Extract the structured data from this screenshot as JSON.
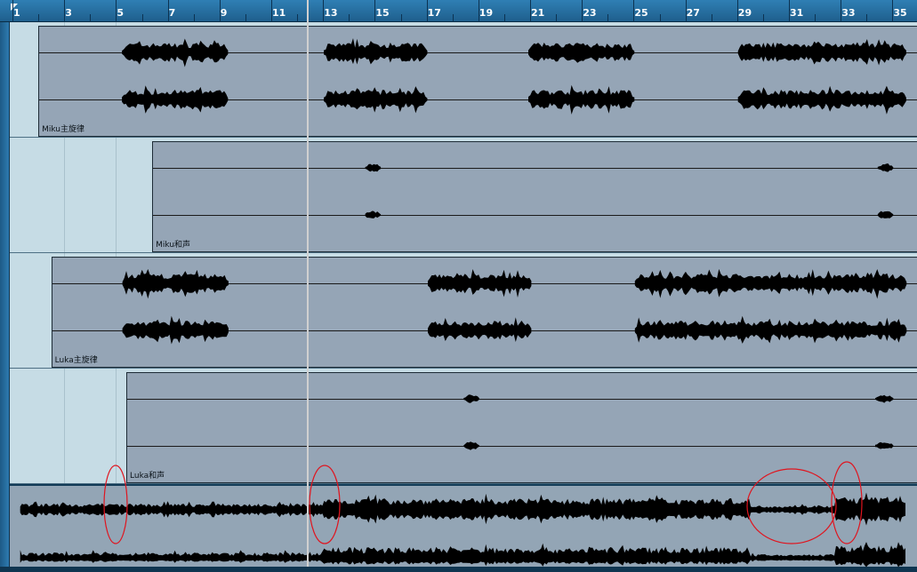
{
  "ruler": {
    "bars": [
      "1",
      "3",
      "5",
      "7",
      "9",
      "11",
      "13",
      "15",
      "17",
      "19",
      "21",
      "23",
      "25",
      "27",
      "29",
      "31",
      "33",
      "35"
    ]
  },
  "tracks": [
    {
      "name": "Miku主旋律",
      "start_bar": 2.0,
      "segments": [
        [
          5.2,
          9.3
        ],
        [
          13.0,
          17.0
        ],
        [
          20.9,
          25.0
        ],
        [
          29.0,
          35.5
        ]
      ]
    },
    {
      "name": "Miku和声",
      "start_bar": 6.4,
      "segments": [
        [
          14.6,
          15.2
        ],
        [
          34.4,
          35.0
        ]
      ]
    },
    {
      "name": "Luka主旋律",
      "start_bar": 2.5,
      "segments": [
        [
          5.2,
          9.3
        ],
        [
          17.0,
          21.0
        ],
        [
          25.0,
          35.5
        ]
      ]
    },
    {
      "name": "Luka和声",
      "start_bar": 5.4,
      "segments": [
        [
          18.4,
          19.0
        ],
        [
          34.3,
          35.0
        ]
      ]
    }
  ],
  "mixdown": {
    "segments": [
      [
        1.3,
        35.5
      ]
    ]
  },
  "colors": {
    "ruler": "#2f7fb4",
    "lane": "#c6dce5",
    "event": "#95a5b6",
    "waveform": "#000000",
    "annotation": "#e0141e"
  },
  "annotations": [
    {
      "shape": "ellipse",
      "color": "#e0141e"
    },
    {
      "shape": "ellipse",
      "color": "#e0141e"
    },
    {
      "shape": "ellipse",
      "color": "#e0141e"
    },
    {
      "shape": "ellipse",
      "color": "#e0141e"
    }
  ]
}
